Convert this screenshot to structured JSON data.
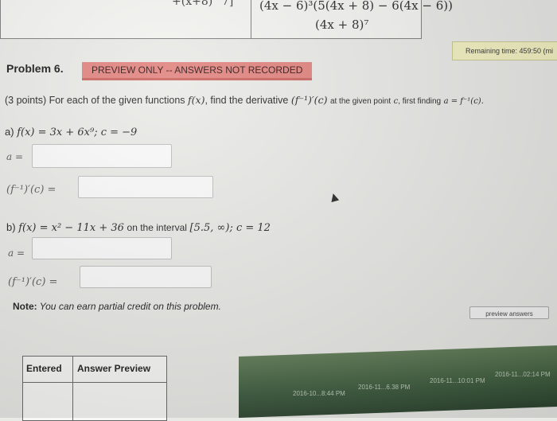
{
  "top_table": {
    "left_fragment": "+(x+8)^7]",
    "right_numerator": "(4x − 6)³(5(4x + 8) − 6(4x − 6))",
    "right_denominator": "(4x + 8)⁷"
  },
  "timer": {
    "label": "Remaining time: 459:50 (mi"
  },
  "problem": {
    "title": "Problem 6.",
    "preview_badge": "PREVIEW ONLY -- ANSWERS NOT RECORDED",
    "points": "(3 points)",
    "intro_text": "For each of the given functions",
    "fx": "f(x)",
    "find_text": ", find the derivative",
    "inverse_deriv": "(f⁻¹)′(c)",
    "at_text": "at the given point",
    "c_symbol": "c",
    "first_text": ", first finding",
    "a_eq": "a = f⁻¹(c)."
  },
  "part_a": {
    "label": "a)",
    "function": "f(x) = 3x + 6x⁹; c = −9",
    "a_label": "a =",
    "deriv_label": "(f⁻¹)′(c) ="
  },
  "part_b": {
    "label": "b)",
    "function_lead": "f(x) = x² − 11x + 36",
    "on_text": "on the interval",
    "interval": "[5.5, ∞); c = 12",
    "a_label": "a =",
    "deriv_label": "(f⁻¹)′(c) ="
  },
  "note": {
    "bold": "Note:",
    "text": " You can earn partial credit on this problem."
  },
  "preview_button": "preview answers",
  "entered_table": {
    "col1": "Entered",
    "col2": "Answer Preview"
  },
  "taskbar": {
    "items": [
      "2016-10...8:44 PM",
      "2016-11...6.38 PM",
      "2016-11...10:01 PM",
      "2016-11...02:14 PM"
    ]
  }
}
